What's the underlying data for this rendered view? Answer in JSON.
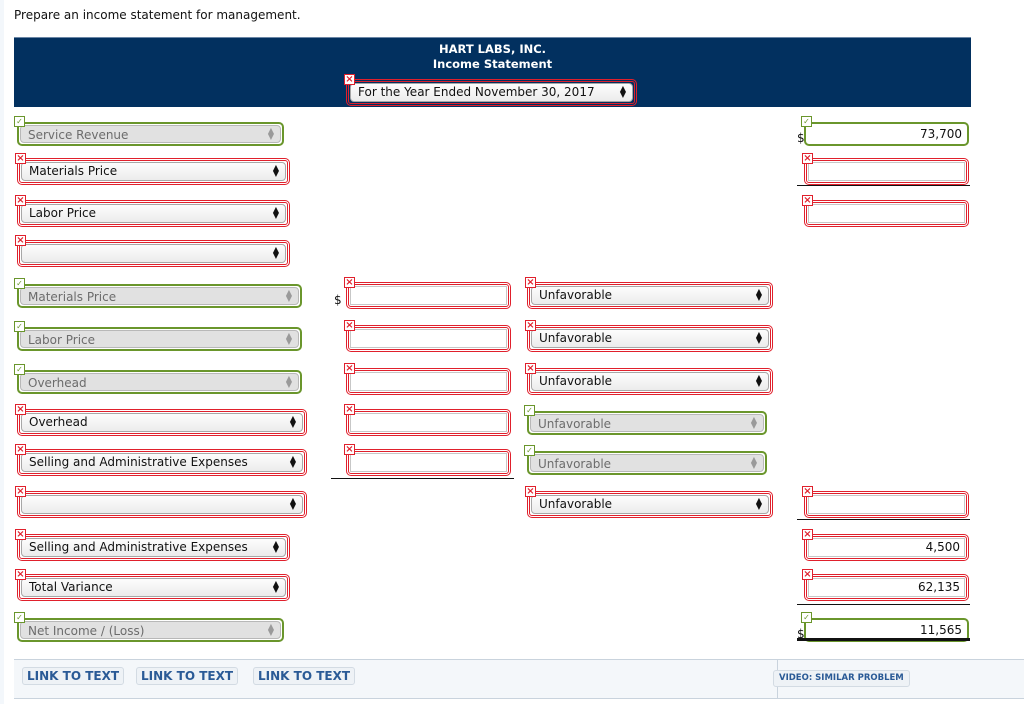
{
  "instruction": "Prepare an income statement for management.",
  "header": {
    "company": "HART LABS, INC.",
    "statement": "Income Statement",
    "period": {
      "value": "For the Year Ended November 30, 2017",
      "status": "incorrect"
    }
  },
  "status_colors": {
    "incorrect": "#e0202c",
    "correct": "#6a962c",
    "header_bg": "#02305f",
    "link": "#2a5a96"
  },
  "rows": [
    {
      "label": {
        "value": "Service Revenue",
        "status": "correct"
      },
      "total": {
        "value": "73,700",
        "status": "correct",
        "currency": "$"
      }
    },
    {
      "label": {
        "value": "Materials Price",
        "status": "incorrect"
      },
      "total": {
        "value": "",
        "status": "incorrect"
      }
    },
    {
      "label": {
        "value": "Labor Price",
        "status": "incorrect"
      },
      "total": {
        "value": "",
        "status": "incorrect"
      }
    },
    {
      "label": {
        "value": "",
        "status": "incorrect"
      }
    },
    {
      "label": {
        "value": "Materials Price",
        "status": "correct"
      },
      "amount": {
        "value": "",
        "status": "incorrect",
        "currency": "$"
      },
      "type": {
        "value": "Unfavorable",
        "status": "incorrect"
      }
    },
    {
      "label": {
        "value": "Labor Price",
        "status": "correct"
      },
      "amount": {
        "value": "",
        "status": "incorrect"
      },
      "type": {
        "value": "Unfavorable",
        "status": "incorrect"
      }
    },
    {
      "label": {
        "value": "Overhead",
        "status": "correct"
      },
      "amount": {
        "value": "",
        "status": "incorrect"
      },
      "type": {
        "value": "Unfavorable",
        "status": "incorrect"
      }
    },
    {
      "label": {
        "value": "Overhead",
        "status": "incorrect"
      },
      "amount": {
        "value": "",
        "status": "incorrect"
      },
      "type": {
        "value": "Unfavorable",
        "status": "correct"
      }
    },
    {
      "label": {
        "value": "Selling and Administrative Expenses",
        "status": "incorrect"
      },
      "amount": {
        "value": "",
        "status": "incorrect"
      },
      "type": {
        "value": "Unfavorable",
        "status": "correct"
      }
    },
    {
      "label": {
        "value": "",
        "status": "incorrect"
      },
      "type": {
        "value": "Unfavorable",
        "status": "incorrect"
      },
      "total": {
        "value": "",
        "status": "incorrect"
      }
    },
    {
      "label": {
        "value": "Selling and Administrative Expenses",
        "status": "incorrect"
      },
      "total": {
        "value": "4,500",
        "status": "incorrect"
      }
    },
    {
      "label": {
        "value": "Total Variance",
        "status": "incorrect"
      },
      "total": {
        "value": "62,135",
        "status": "incorrect"
      }
    },
    {
      "label": {
        "value": "Net Income / (Loss)",
        "status": "correct"
      },
      "total": {
        "value": "11,565",
        "status": "correct",
        "currency": "$"
      }
    }
  ],
  "footer": {
    "links": [
      "LINK TO TEXT",
      "LINK TO TEXT",
      "LINK TO TEXT"
    ],
    "video": "VIDEO: SIMILAR PROBLEM"
  },
  "icons": {
    "incorrect": "x-mark-icon",
    "correct": "check-mark-icon",
    "select": "up-down-arrows-icon"
  }
}
